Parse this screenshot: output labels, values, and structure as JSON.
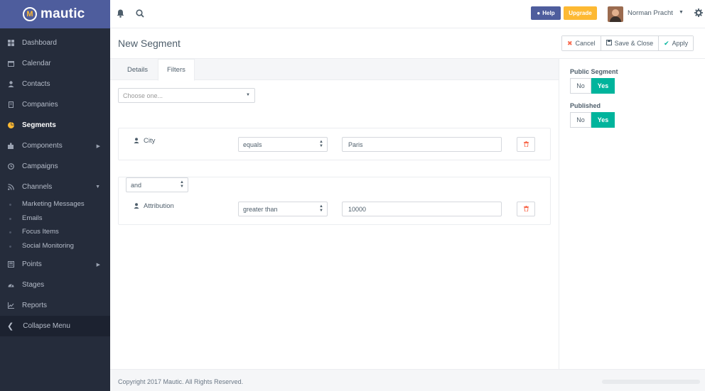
{
  "brand": {
    "name": "mautic",
    "logo_letter": "M"
  },
  "sidebar": {
    "items": [
      {
        "label": "Dashboard",
        "icon": "grid-icon"
      },
      {
        "label": "Calendar",
        "icon": "calendar-icon"
      },
      {
        "label": "Contacts",
        "icon": "user-icon"
      },
      {
        "label": "Companies",
        "icon": "building-icon"
      },
      {
        "label": "Segments",
        "icon": "pie-chart-icon",
        "active": true
      },
      {
        "label": "Components",
        "icon": "puzzle-icon",
        "has_children": true
      },
      {
        "label": "Campaigns",
        "icon": "clock-icon"
      },
      {
        "label": "Channels",
        "icon": "rss-icon",
        "has_children": true
      }
    ],
    "channel_subitems": [
      "Marketing Messages",
      "Emails",
      "Focus Items",
      "Social Monitoring"
    ],
    "items_after": [
      {
        "label": "Points",
        "icon": "calculator-icon",
        "has_children": true
      },
      {
        "label": "Stages",
        "icon": "tachometer-icon"
      },
      {
        "label": "Reports",
        "icon": "line-chart-icon"
      }
    ],
    "collapse_label": "Collapse Menu"
  },
  "topbar": {
    "help_label": "Help",
    "upgrade_label": "Upgrade",
    "user_name": "Norman Pracht"
  },
  "header": {
    "title": "New Segment",
    "cancel_label": "Cancel",
    "save_close_label": "Save & Close",
    "apply_label": "Apply"
  },
  "tabs": [
    {
      "label": "Details",
      "active": false
    },
    {
      "label": "Filters",
      "active": true
    }
  ],
  "filters": {
    "add_placeholder": "Choose one...",
    "rows": [
      {
        "field": "City",
        "operator": "equals",
        "value": "Paris"
      },
      {
        "glue": "and",
        "field": "Attribution",
        "operator": "greater than",
        "value": "10000"
      }
    ]
  },
  "right_panel": {
    "public_segment_label": "Public Segment",
    "published_label": "Published",
    "no_label": "No",
    "yes_label": "Yes"
  },
  "footer": {
    "copyright": "Copyright 2017 Mautic. All Rights Reserved."
  },
  "colors": {
    "sidebar_bg": "#252c3b",
    "logo_bar": "#4e5d9d",
    "accent_yellow": "#fdb933",
    "accent_green": "#00b49c",
    "danger": "#f86b4f"
  }
}
